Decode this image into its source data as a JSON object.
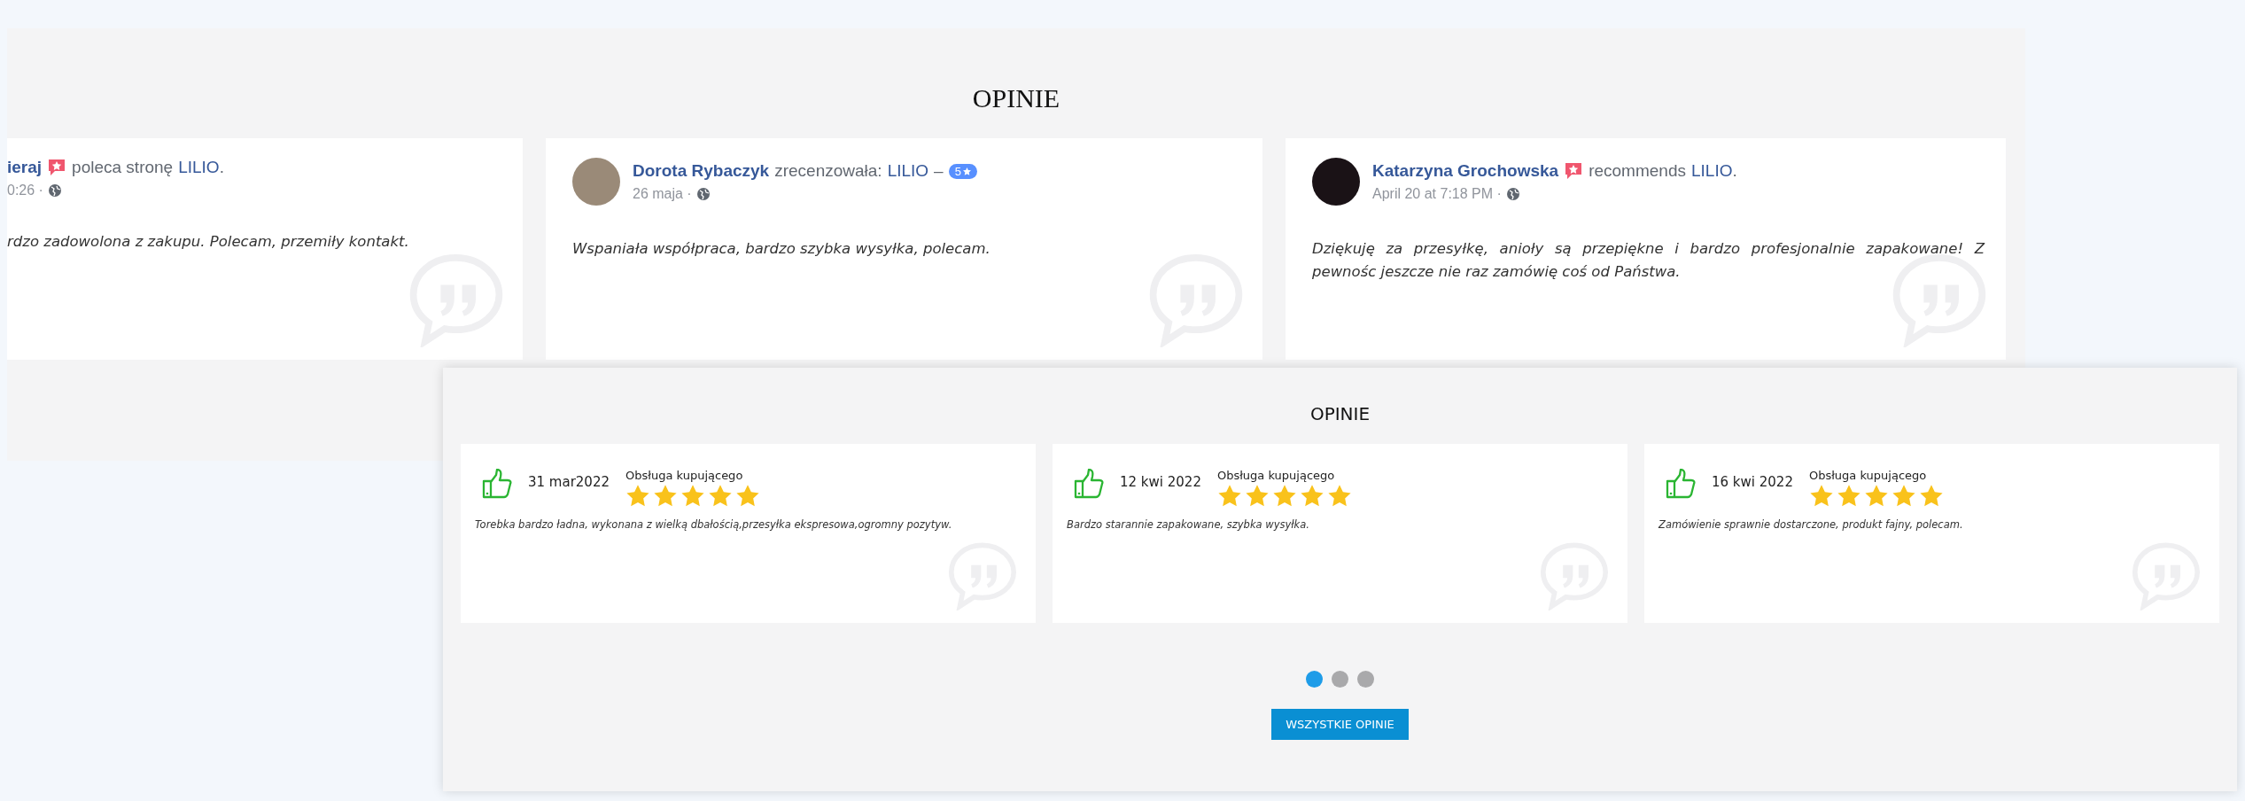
{
  "top_panel": {
    "title": "OPINIE",
    "reviews": [
      {
        "kind": "recommend",
        "avatar": false,
        "name": "ieraj",
        "action": "poleca stronę",
        "page": "LILIO",
        "suffix": ".",
        "time": "0:26 ·",
        "text": "rdzo zadowolona z zakupu. Polecam, przemiły kontakt."
      },
      {
        "kind": "review",
        "avatar": true,
        "name": "Dorota Rybaczyk",
        "action": "zrecenzowała:",
        "page": "LILIO",
        "suffix": " –",
        "rating": "5",
        "time": "26 maja ·",
        "text": "Wspaniała współpraca, bardzo szybka wysyłka, polecam."
      },
      {
        "kind": "recommend",
        "avatar": true,
        "name": "Katarzyna Grochowska",
        "action": "recommends",
        "page": "LILIO",
        "suffix": ".",
        "time": "April 20 at 7:18 PM ·",
        "text": "Dziękuję za przesyłkę, anioły są przepiękne i bardzo profesjonalnie zapakowane! Z pewnośc jeszcze nie raz zamówię coś od Państwa."
      }
    ]
  },
  "bottom_panel": {
    "title": "OPINIE",
    "reviews": [
      {
        "date": "31 mar2022",
        "category": "Obsługa kupującego",
        "stars": 5,
        "text": "Torebka bardzo ładna, wykonana z wielką dbałością,przesyłka ekspresowa,ogromny pozytyw."
      },
      {
        "date": "12 kwi 2022",
        "category": "Obsługa kupującego",
        "stars": 5,
        "text": "Bardzo starannie zapakowane, szybka wysyłka."
      },
      {
        "date": "16 kwi 2022",
        "category": "Obsługa kupującego",
        "stars": 5,
        "text": "Zamówienie sprawnie dostarczone, produkt fajny, polecam."
      }
    ],
    "pages": [
      {
        "selected": true
      },
      {
        "selected": false
      },
      {
        "selected": false
      }
    ],
    "button": "WSZYSTKIE OPINIE"
  }
}
